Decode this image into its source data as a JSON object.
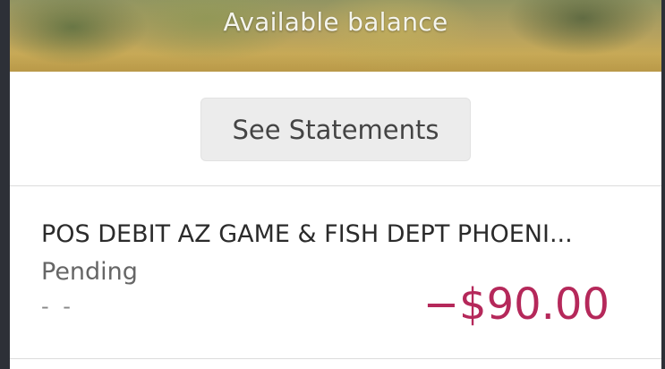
{
  "header": {
    "label": "Available balance"
  },
  "statements": {
    "button_label": "See Statements"
  },
  "transactions": [
    {
      "description": "POS DEBIT AZ GAME & FISH DEPT PHOENI...",
      "status": "Pending",
      "date": "- -",
      "amount": "−$90.00"
    }
  ],
  "colors": {
    "negative_amount": "#b5285a",
    "background_frame": "#2d3037",
    "button_bg": "#ececec"
  }
}
